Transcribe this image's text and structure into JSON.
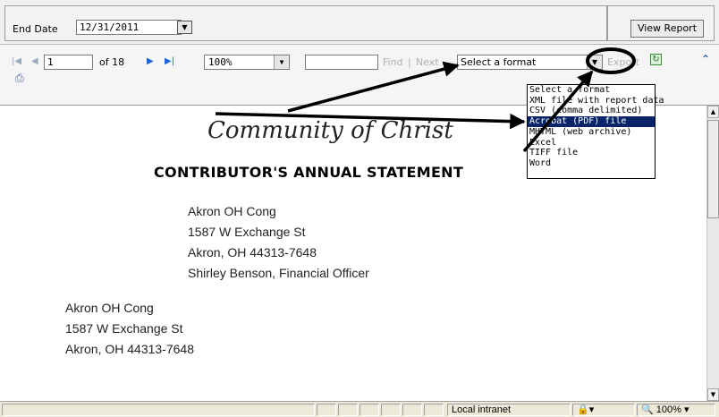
{
  "params": {
    "end_date_label": "End Date",
    "end_date_value": "12/31/2011",
    "view_report_label": "View Report"
  },
  "toolbar": {
    "current_page": "1",
    "page_of": "of 18",
    "zoom": "100%",
    "find_label": "Find",
    "separator": "|",
    "next_label": "Next",
    "format_selected": "Select a format",
    "export_label": "Export",
    "icons": [
      "first-page-icon",
      "prev-page-icon",
      "next-page-icon",
      "last-page-icon",
      "refresh-icon",
      "collapse-icon",
      "print-icon"
    ]
  },
  "format_options": [
    "Select a format",
    "XML file with report data",
    "CSV (comma delimited)",
    "Acrobat (PDF) file",
    "MHTML (web archive)",
    "Excel",
    "TIFF file",
    "Word"
  ],
  "format_selected_index": 3,
  "report": {
    "title": "Community of Christ",
    "heading": "CONTRIBUTOR'S ANNUAL STATEMENT",
    "sender": [
      "Akron OH Cong",
      "1587 W Exchange St",
      "Akron, OH 44313-7648",
      "Shirley Benson, Financial Officer"
    ],
    "recipient": [
      "Akron OH Cong",
      "1587 W Exchange St",
      "Akron, OH 44313-7648"
    ]
  },
  "statusbar": {
    "zone": "Local intranet",
    "zoom": "100%"
  },
  "colors": {
    "selection": "#0a246a",
    "nav_active": "#1a63d8",
    "annotation": "#000000"
  }
}
